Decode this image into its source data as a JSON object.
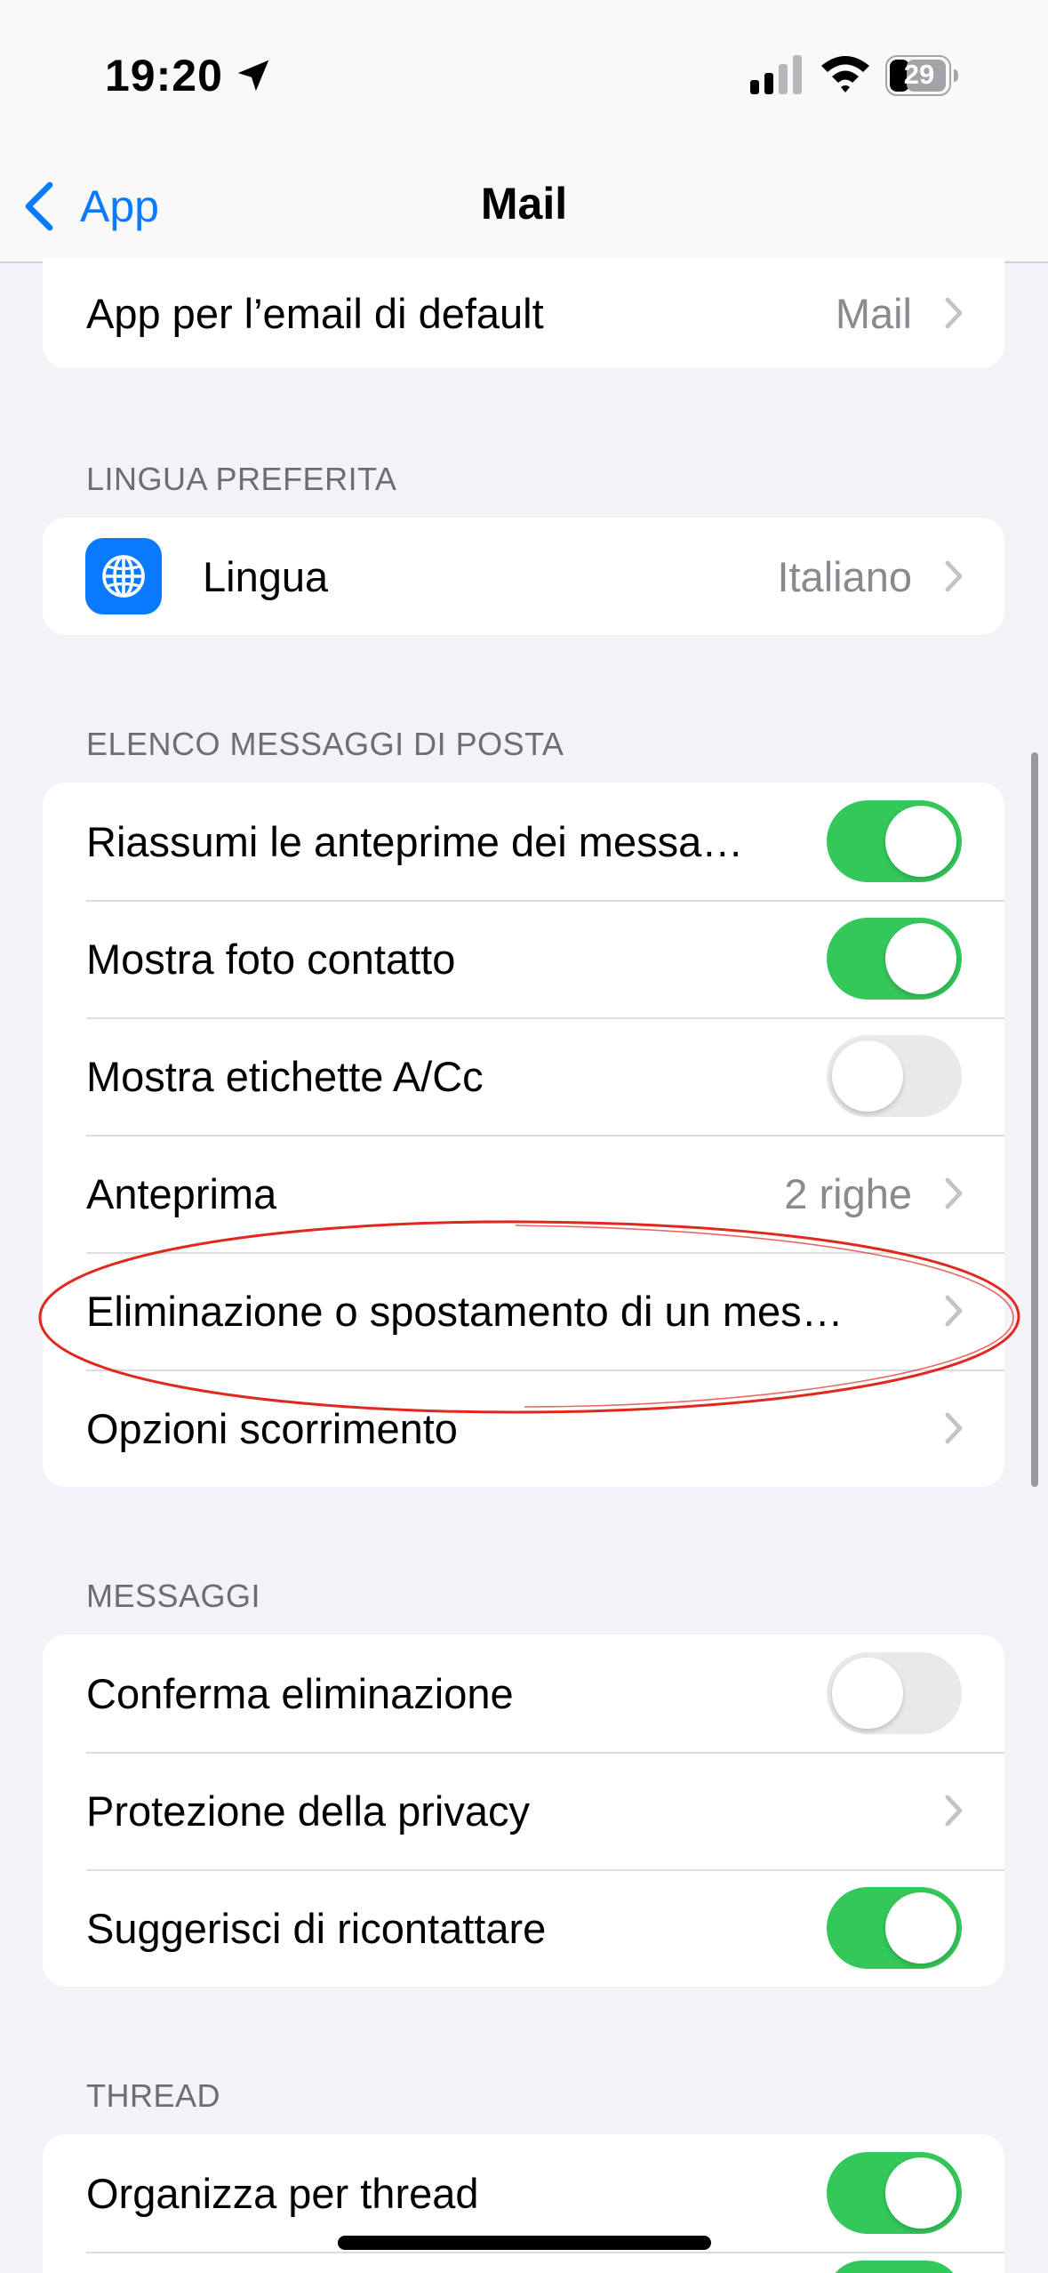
{
  "status_bar": {
    "time": "19:20",
    "battery": "29"
  },
  "nav": {
    "back_label": "App",
    "title": "Mail"
  },
  "group_default": {
    "items": [
      {
        "label": "App per l’email di default",
        "value": "Mail",
        "type": "link"
      }
    ]
  },
  "section_lingua": {
    "header": "LINGUA PREFERITA",
    "items": [
      {
        "label": "Lingua",
        "value": "Italiano",
        "type": "link",
        "icon": "globe-icon"
      }
    ]
  },
  "section_elenco": {
    "header": "ELENCO MESSAGGI DI POSTA",
    "items": [
      {
        "label": "Riassumi le anteprime dei messa…",
        "type": "toggle",
        "on": true
      },
      {
        "label": "Mostra foto contatto",
        "type": "toggle",
        "on": true
      },
      {
        "label": "Mostra etichette A/Cc",
        "type": "toggle",
        "on": false
      },
      {
        "label": "Anteprima",
        "value": "2 righe",
        "type": "link"
      },
      {
        "label": "Eliminazione o spostamento di un mes…",
        "type": "link"
      },
      {
        "label": "Opzioni scorrimento",
        "type": "link"
      }
    ]
  },
  "section_messaggi": {
    "header": "MESSAGGI",
    "items": [
      {
        "label": "Conferma eliminazione",
        "type": "toggle",
        "on": false
      },
      {
        "label": "Protezione della privacy",
        "type": "link"
      },
      {
        "label": "Suggerisci di ricontattare",
        "type": "toggle",
        "on": true
      }
    ]
  },
  "section_thread": {
    "header": "THREAD",
    "items": [
      {
        "label": "Organizza per thread",
        "type": "toggle",
        "on": true
      }
    ]
  },
  "colors": {
    "accent": "#0a7aff",
    "toggle_on": "#34c759",
    "toggle_off": "#e9e9ea",
    "annotation": "#e0281e"
  }
}
